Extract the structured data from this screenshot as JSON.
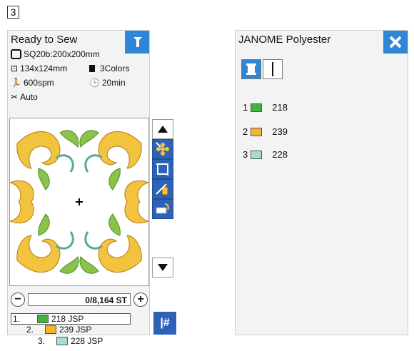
{
  "step_label": "3",
  "left": {
    "title": "Ready to Sew",
    "hoop": "SQ20b:200x200mm",
    "size": "134x124mm",
    "colors": "3Colors",
    "speed": "600spm",
    "time": "20min",
    "cut_mode": "Auto",
    "stitch_counter": "0/8,164 ST",
    "minus_label": "−",
    "plus_label": "+",
    "threads": [
      {
        "num": "1.",
        "code": "218 JSP",
        "color": "#3fb43f"
      },
      {
        "num": "2.",
        "code": "239 JSP",
        "color": "#f3b531"
      },
      {
        "num": "3.",
        "code": "228 JSP",
        "color": "#a6dbd8"
      }
    ],
    "hash_label": "|#"
  },
  "right": {
    "title": "JANOME Polyester",
    "threads": [
      {
        "num": "1",
        "code": "218",
        "color": "#3fb43f"
      },
      {
        "num": "2",
        "code": "239",
        "color": "#f3b531"
      },
      {
        "num": "3",
        "code": "228",
        "color": "#a6dbd8"
      }
    ]
  }
}
